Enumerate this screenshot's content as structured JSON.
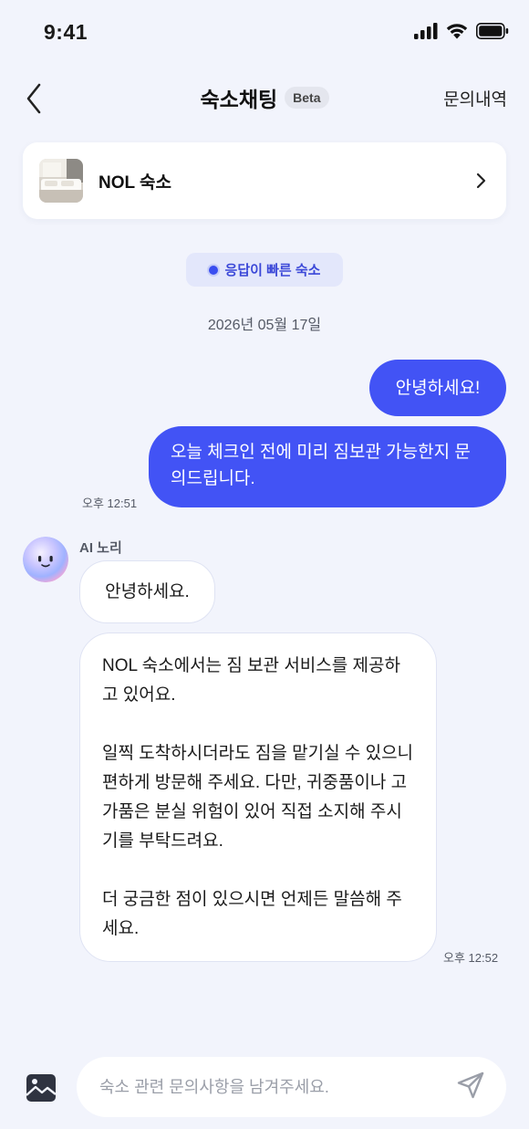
{
  "status_bar": {
    "time": "9:41",
    "icons": [
      "signal-icon",
      "wifi-icon",
      "battery-icon"
    ]
  },
  "header": {
    "back_icon": "chevron-left-icon",
    "title": "숙소채팅",
    "badge": "Beta",
    "history_label": "문의내역"
  },
  "hotel_card": {
    "name": "NOL 숙소",
    "chevron_icon": "chevron-right-icon"
  },
  "chat": {
    "fast_badge": "응답이 빠른 숙소",
    "date": "2026년 05월 17일",
    "user_messages": [
      {
        "text": "안녕하세요!"
      },
      {
        "text": "오늘 체크인 전에 미리 짐보관 가능한지 문의드립니다."
      }
    ],
    "user_time": "오후 12:51",
    "ai_name": "AI 노리",
    "ai_messages": [
      {
        "text": "안녕하세요."
      },
      {
        "paragraphs": [
          "NOL 숙소에서는 짐 보관 서비스를 제공하고 있어요.",
          "일찍 도착하시더라도 짐을 맡기실 수 있으니 편하게 방문해 주세요. 다만, 귀중품이나 고가품은 분실 위험이 있어 직접 소지해 주시기를 부탁드려요.",
          "더 궁금한 점이 있으시면 언제든 말씀해 주세요."
        ]
      }
    ],
    "ai_time": "오후 12:52"
  },
  "input_bar": {
    "placeholder": "숙소 관련 문의사항을 남겨주세요.",
    "value": "",
    "image_icon": "image-icon",
    "send_icon": "send-icon"
  },
  "colors": {
    "accent": "#4253F5",
    "background": "#F2F4FC",
    "badge_bg": "#E3E7FB"
  }
}
